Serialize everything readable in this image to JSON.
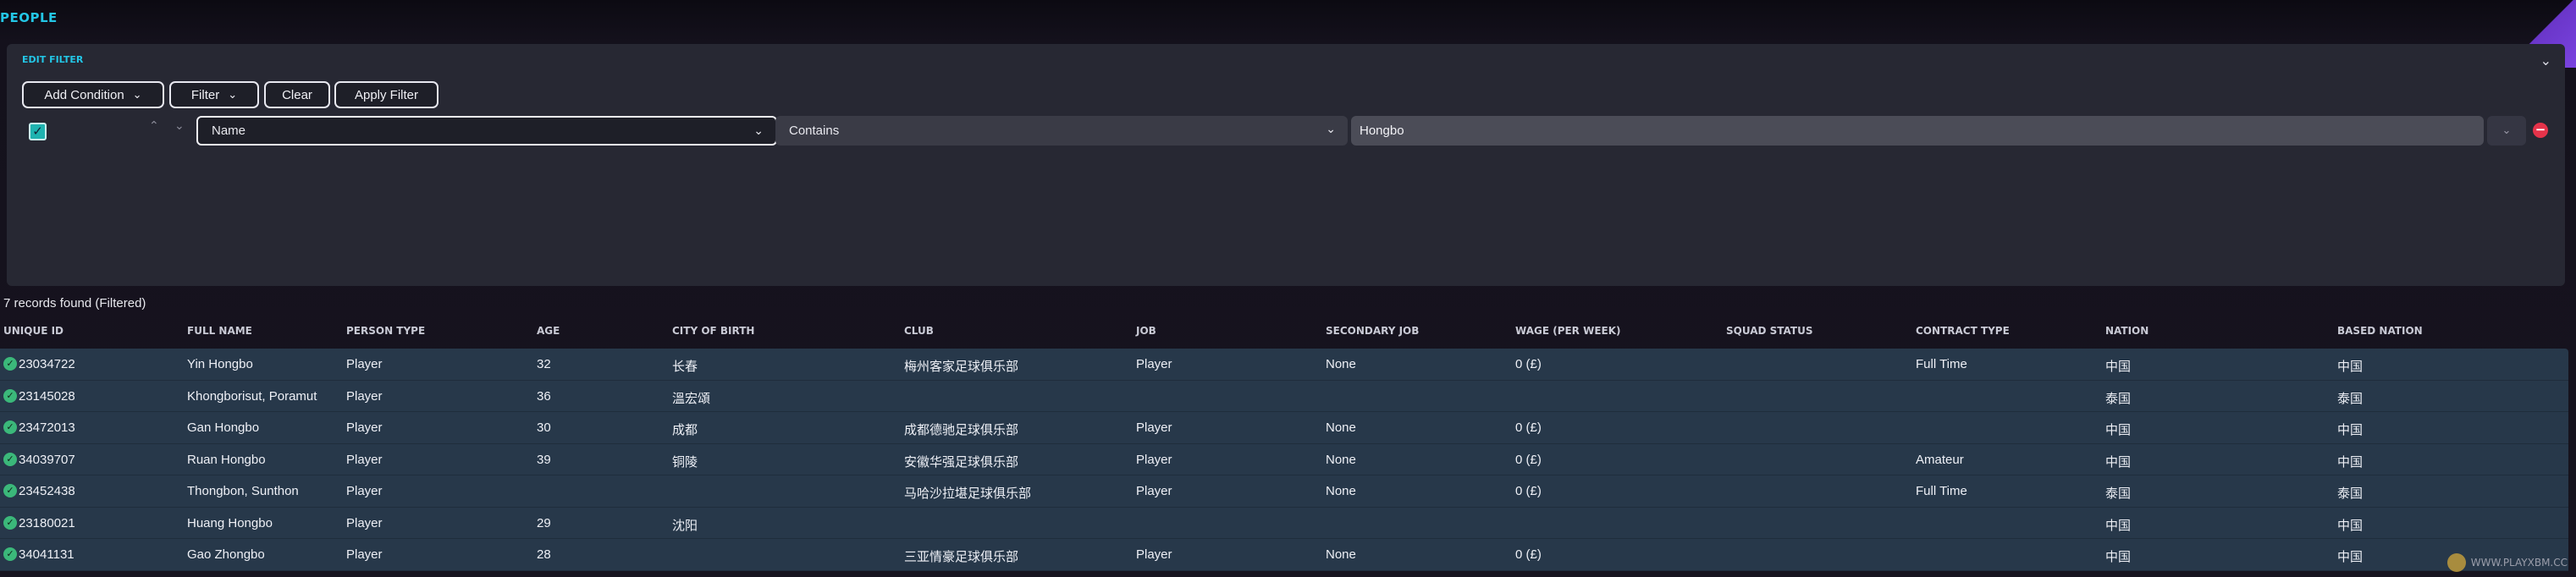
{
  "page": {
    "title": "PEOPLE"
  },
  "filter": {
    "panel_title": "EDIT FILTER",
    "buttons": {
      "add_condition": "Add Condition",
      "filter": "Filter",
      "clear": "Clear",
      "apply": "Apply Filter"
    },
    "condition": {
      "enabled": true,
      "field": "Name",
      "operator": "Contains",
      "value": "Hongbo"
    }
  },
  "records_text": "7 records found (Filtered)",
  "columns": [
    "UNIQUE ID",
    "FULL NAME",
    "PERSON TYPE",
    "AGE",
    "CITY OF BIRTH",
    "CLUB",
    "JOB",
    "SECONDARY JOB",
    "WAGE (PER WEEK)",
    "SQUAD STATUS",
    "CONTRACT TYPE",
    "NATION",
    "BASED NATION"
  ],
  "rows": [
    [
      "23034722",
      "Yin Hongbo",
      "Player",
      "32",
      "长春",
      "梅州客家足球俱乐部",
      "Player",
      "None",
      "0 (£)",
      "",
      "Full Time",
      "中国",
      "中国"
    ],
    [
      "23145028",
      "Khongborisut, Poramut",
      "Player",
      "36",
      "溫宏頌",
      "",
      "",
      "",
      "",
      "",
      "",
      "泰国",
      "泰国"
    ],
    [
      "23472013",
      "Gan Hongbo",
      "Player",
      "30",
      "成都",
      "成都德驰足球俱乐部",
      "Player",
      "None",
      "0 (£)",
      "",
      "",
      "中国",
      "中国"
    ],
    [
      "34039707",
      "Ruan Hongbo",
      "Player",
      "39",
      "铜陵",
      "安徽华强足球俱乐部",
      "Player",
      "None",
      "0 (£)",
      "",
      "Amateur",
      "中国",
      "中国"
    ],
    [
      "23452438",
      "Thongbon, Sunthon",
      "Player",
      "",
      "",
      "马哈沙拉堪足球俱乐部",
      "Player",
      "None",
      "0 (£)",
      "",
      "Full Time",
      "泰国",
      "泰国"
    ],
    [
      "23180021",
      "Huang Hongbo",
      "Player",
      "29",
      "沈阳",
      "",
      "",
      "",
      "",
      "",
      "",
      "中国",
      "中国"
    ],
    [
      "34041131",
      "Gao Zhongbo",
      "Player",
      "28",
      "",
      "三亚情豪足球俱乐部",
      "Player",
      "None",
      "0 (£)",
      "",
      "",
      "中国",
      "中国"
    ]
  ],
  "watermark": "WWW.PLAYXBM.CC"
}
